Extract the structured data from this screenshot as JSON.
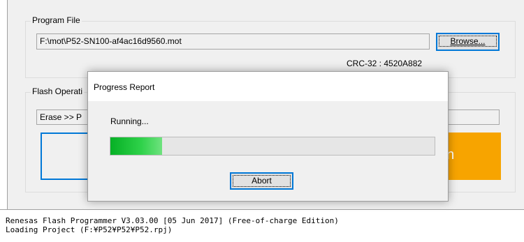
{
  "program_file": {
    "group_title": "Program File",
    "path_value": "F:\\mot\\P52-SN100-af4ac16d9560.mot",
    "browse_label": "Browse...",
    "crc_text": "CRC-32 : 4520A882"
  },
  "flash_operation": {
    "group_title": "Flash Operati",
    "operation_value": "Erase >> P",
    "run_label": "un"
  },
  "dialog": {
    "title": "Progress Report",
    "status_text": "Running...",
    "progress": 0.16,
    "abort_label": "Abort"
  },
  "log": {
    "lines": [
      "Renesas Flash Programmer V3.03.00 [05 Jun 2017] (Free-of-charge Edition)",
      "Loading Project (F:¥P52¥P52¥P52.rpj)"
    ]
  },
  "colors": {
    "run_button": "#f7a400",
    "progress_green": "#06b025",
    "default_button_border": "#0078d7"
  }
}
